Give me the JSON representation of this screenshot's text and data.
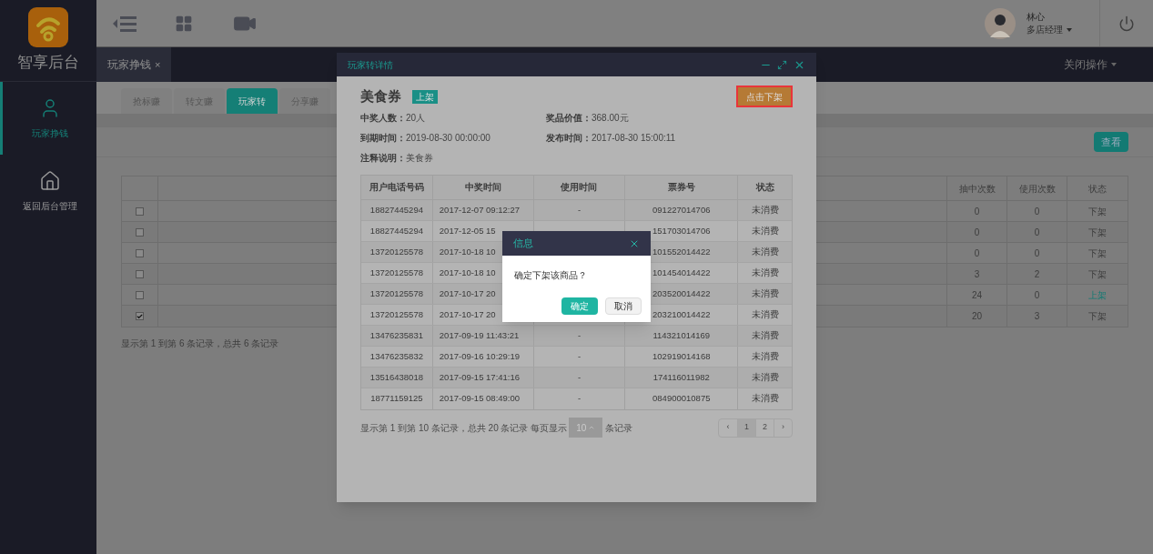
{
  "sidebar": {
    "logo_text": "智享后台",
    "items": [
      {
        "label": "玩家挣钱",
        "selected": true,
        "kind": "user"
      },
      {
        "label": "返回后台管理",
        "selected": false,
        "kind": "home"
      }
    ]
  },
  "user": {
    "name": "林心",
    "role": "多店经理"
  },
  "page_tabs": [
    {
      "label": "玩家挣钱",
      "close": "×",
      "selected": true
    }
  ],
  "close_ops": "关闭操作",
  "sub_tabs": [
    {
      "label": "抢标赚",
      "selected": false
    },
    {
      "label": "转文赚",
      "selected": false
    },
    {
      "label": "玩家转",
      "selected": true
    },
    {
      "label": "分享赚",
      "selected": false
    }
  ],
  "view_button": "查看",
  "list": {
    "columns": [
      "抽中次数",
      "使用次数",
      "状态"
    ],
    "rows": [
      {
        "checked": false,
        "draw_count": "0",
        "use_count": "0",
        "status": "下架",
        "listed": false
      },
      {
        "checked": false,
        "draw_count": "0",
        "use_count": "0",
        "status": "下架",
        "listed": false
      },
      {
        "checked": false,
        "draw_count": "0",
        "use_count": "0",
        "status": "下架",
        "listed": false
      },
      {
        "checked": false,
        "draw_count": "3",
        "use_count": "2",
        "status": "下架",
        "listed": false
      },
      {
        "checked": false,
        "draw_count": "24",
        "use_count": "0",
        "status": "上架",
        "listed": true
      },
      {
        "checked": true,
        "draw_count": "20",
        "use_count": "3",
        "status": "下架",
        "listed": false
      }
    ],
    "footer": "显示第 1 到第 6 条记录，总共 6 条记录"
  },
  "detail": {
    "title": "玩家转详情",
    "name": "美食券",
    "badge": "上架",
    "action_button": "点击下架",
    "fields": [
      {
        "label": "中奖人数：",
        "value": "20人"
      },
      {
        "label": "奖品价值：",
        "value": "368.00元"
      },
      {
        "label": "到期时间：",
        "value": "2019-08-30 00:00:00"
      },
      {
        "label": "发布时间：",
        "value": "2017-08-30 15:00:11"
      },
      {
        "label": "注释说明：",
        "value": "美食券"
      }
    ],
    "columns": [
      "用户电话号码",
      "中奖时间",
      "使用时间",
      "票券号",
      "状态"
    ],
    "rows": [
      {
        "phone": "18827445294",
        "win_time": "2017-12-07 09:12:27",
        "use_time": "-",
        "ticket": "091227014706",
        "status": "未消费"
      },
      {
        "phone": "18827445294",
        "win_time": "2017-12-05 15",
        "ticket": "151703014706",
        "status": "未消费"
      },
      {
        "phone": "13720125578",
        "win_time": "2017-10-18 10",
        "ticket": "101552014422",
        "status": "未消费"
      },
      {
        "phone": "13720125578",
        "win_time": "2017-10-18 10",
        "ticket": "101454014422",
        "status": "未消费"
      },
      {
        "phone": "13720125578",
        "win_time": "2017-10-17 20",
        "ticket": "203520014422",
        "status": "未消费"
      },
      {
        "phone": "13720125578",
        "win_time": "2017-10-17 20",
        "ticket": "203210014422",
        "status": "未消费"
      },
      {
        "phone": "13476235831",
        "win_time": "2017-09-19 11:43:21",
        "use_time": "-",
        "ticket": "114321014169",
        "status": "未消费"
      },
      {
        "phone": "13476235832",
        "win_time": "2017-09-16 10:29:19",
        "use_time": "-",
        "ticket": "102919014168",
        "status": "未消费"
      },
      {
        "phone": "13516438018",
        "win_time": "2017-09-15 17:41:16",
        "use_time": "-",
        "ticket": "174116011982",
        "status": "未消费"
      },
      {
        "phone": "18771159125",
        "win_time": "2017-09-15 08:49:00",
        "use_time": "-",
        "ticket": "084900010875",
        "status": "未消费"
      }
    ],
    "footer": {
      "before": "显示第 1 到第 10 条记录，总共 20 条记录 每页显示",
      "page_size": "10",
      "after": "条记录"
    },
    "pagination": [
      {
        "label": "‹",
        "selected": false
      },
      {
        "label": "1",
        "selected": true
      },
      {
        "label": "2",
        "selected": false
      },
      {
        "label": "›",
        "selected": false
      }
    ]
  },
  "dialog": {
    "title": "信息",
    "message": "确定下架该商品？",
    "confirm": "确定",
    "cancel": "取消"
  }
}
